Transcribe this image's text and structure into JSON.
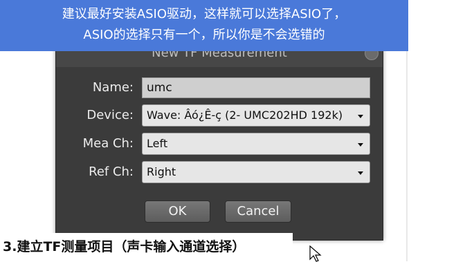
{
  "banner": {
    "line1": "建议最好安装ASIO驱动，这样就可以选择ASIO了，",
    "line2": "ASIO的选择只有一个，所以你是不会选错的"
  },
  "dialog": {
    "title": "New TF Measurement",
    "fields": {
      "name_label": "Name:",
      "name_value": "umc",
      "device_label": "Device:",
      "device_value": "Wave: Âó¿Ê-ç (2- UMC202HD 192k)",
      "mea_label": "Mea Ch:",
      "mea_value": "Left",
      "ref_label": "Ref Ch:",
      "ref_value": "Right"
    },
    "ok_label": "OK",
    "cancel_label": "Cancel"
  },
  "caption": "3.建立TF测量项目（声卡输入通道选择）",
  "colors": {
    "banner": "#4a79d9",
    "dialog_bg": "#3b3b3b"
  }
}
